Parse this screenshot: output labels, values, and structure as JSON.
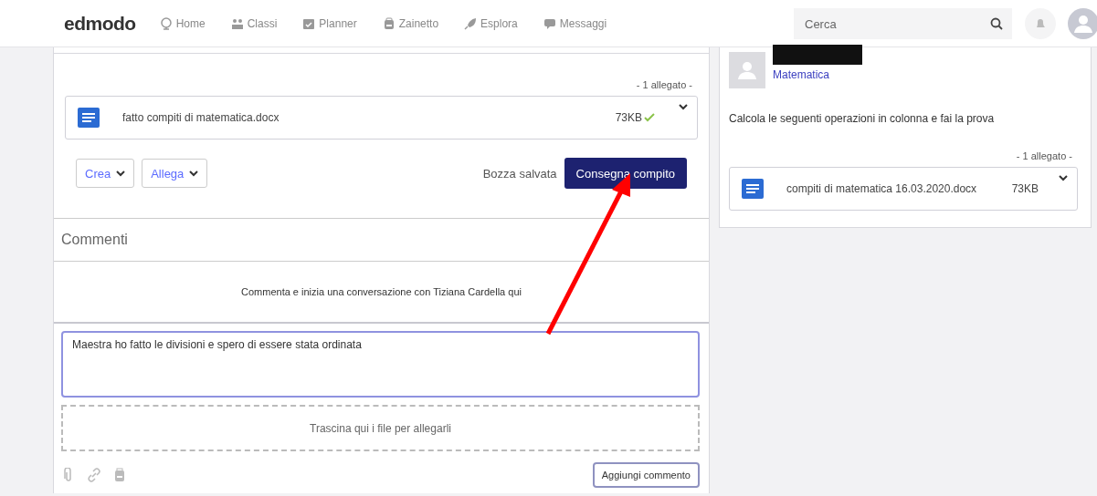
{
  "header": {
    "logo": "edmodo",
    "nav": [
      {
        "label": "Home"
      },
      {
        "label": "Classi"
      },
      {
        "label": "Planner"
      },
      {
        "label": "Zainetto"
      },
      {
        "label": "Esplora"
      },
      {
        "label": "Messaggi"
      }
    ],
    "search": {
      "placeholder": "Cerca"
    }
  },
  "submission": {
    "attachment_count": "- 1 allegato -",
    "attachment": {
      "name": "fatto compiti di matematica.docx",
      "size": "73KB",
      "uploaded": true
    },
    "menus": [
      "Crea",
      "Allega"
    ],
    "draft_status": "Bozza salvata",
    "submit": "Consegna compito"
  },
  "comments": {
    "title": "Commenti",
    "empty_message": "Commenta e inizia una conversazione con Tiziana Cardella qui",
    "input": {
      "value": "Maestra ho fatto le divisioni e spero di essere stata ordinata"
    },
    "dropzone": "Trascina qui i file per allegarli",
    "add_button": "Aggiungi commento"
  },
  "assignment": {
    "author_redacted": true,
    "subject": "Matematica",
    "description": "Calcola le seguenti operazioni in colonna e fai la prova",
    "attachment_count": "- 1 allegato -",
    "attachment": {
      "name": "compiti di matematica 16.03.2020.docx",
      "size": "73KB"
    }
  },
  "annotation": {
    "arrow": true
  }
}
